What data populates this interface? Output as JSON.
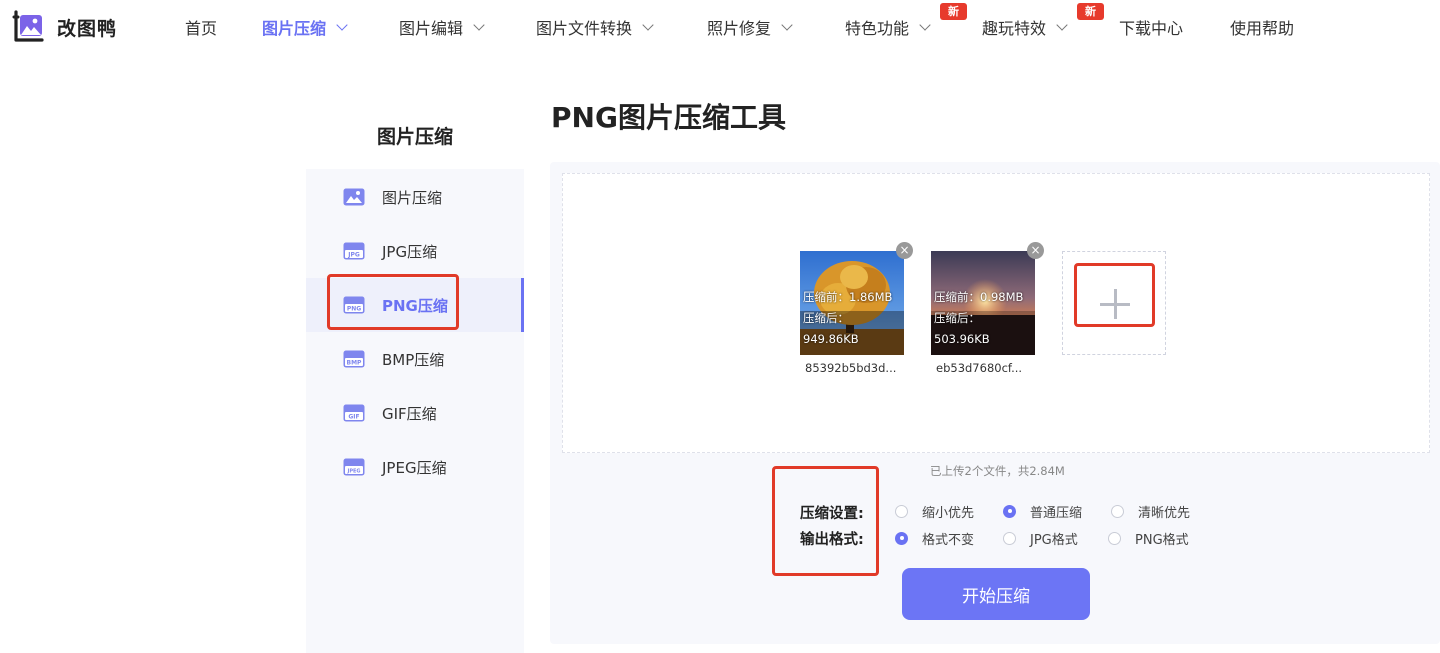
{
  "brand": {
    "name": "改图鸭"
  },
  "nav": [
    {
      "label": "首页",
      "has_dropdown": false,
      "active": false,
      "badge": ""
    },
    {
      "label": "图片压缩",
      "has_dropdown": true,
      "active": true,
      "badge": ""
    },
    {
      "label": "图片编辑",
      "has_dropdown": true,
      "active": false,
      "badge": ""
    },
    {
      "label": "图片文件转换",
      "has_dropdown": true,
      "active": false,
      "badge": ""
    },
    {
      "label": "照片修复",
      "has_dropdown": true,
      "active": false,
      "badge": ""
    },
    {
      "label": "特色功能",
      "has_dropdown": true,
      "active": false,
      "badge": "新"
    },
    {
      "label": "趣玩特效",
      "has_dropdown": true,
      "active": false,
      "badge": "新"
    },
    {
      "label": "下载中心",
      "has_dropdown": false,
      "active": false,
      "badge": ""
    },
    {
      "label": "使用帮助",
      "has_dropdown": false,
      "active": false,
      "badge": ""
    }
  ],
  "sidebar": {
    "title": "图片压缩",
    "items": [
      {
        "label": "图片压缩",
        "icon": "image-icon",
        "active": false
      },
      {
        "label": "JPG压缩",
        "icon": "jpg-file-icon",
        "icon_text": "JPG",
        "active": false
      },
      {
        "label": "PNG压缩",
        "icon": "png-file-icon",
        "icon_text": "PNG",
        "active": true
      },
      {
        "label": "BMP压缩",
        "icon": "bmp-file-icon",
        "icon_text": "BMP",
        "active": false
      },
      {
        "label": "GIF压缩",
        "icon": "gif-file-icon",
        "icon_text": "GIF",
        "active": false
      },
      {
        "label": "JPEG压缩",
        "icon": "jpeg-file-icon",
        "icon_text": "JPEG",
        "active": false
      }
    ]
  },
  "main": {
    "title": "PNG图片压缩工具",
    "files": [
      {
        "name": "85392b5bd3d...",
        "before": "压缩前：1.86MB",
        "after": "压缩后：949.86KB"
      },
      {
        "name": "eb53d7680cf...",
        "before": "压缩前：0.98MB",
        "after": "压缩后：503.96KB"
      }
    ],
    "upload_summary": "已上传2个文件，共2.84M",
    "compression": {
      "label": "压缩设置:",
      "options": [
        {
          "label": "缩小优先",
          "checked": false
        },
        {
          "label": "普通压缩",
          "checked": true
        },
        {
          "label": "清晰优先",
          "checked": false
        }
      ]
    },
    "output": {
      "label": "输出格式:",
      "options": [
        {
          "label": "格式不变",
          "checked": true
        },
        {
          "label": "JPG格式",
          "checked": false
        },
        {
          "label": "PNG格式",
          "checked": false
        }
      ]
    },
    "start_button": "开始压缩"
  },
  "colors": {
    "accent": "#6a72f3",
    "button": "#6c75f5",
    "badge": "#e73a2c",
    "highlight_box": "#e13a28",
    "panel_bg": "#f7f8fc"
  }
}
